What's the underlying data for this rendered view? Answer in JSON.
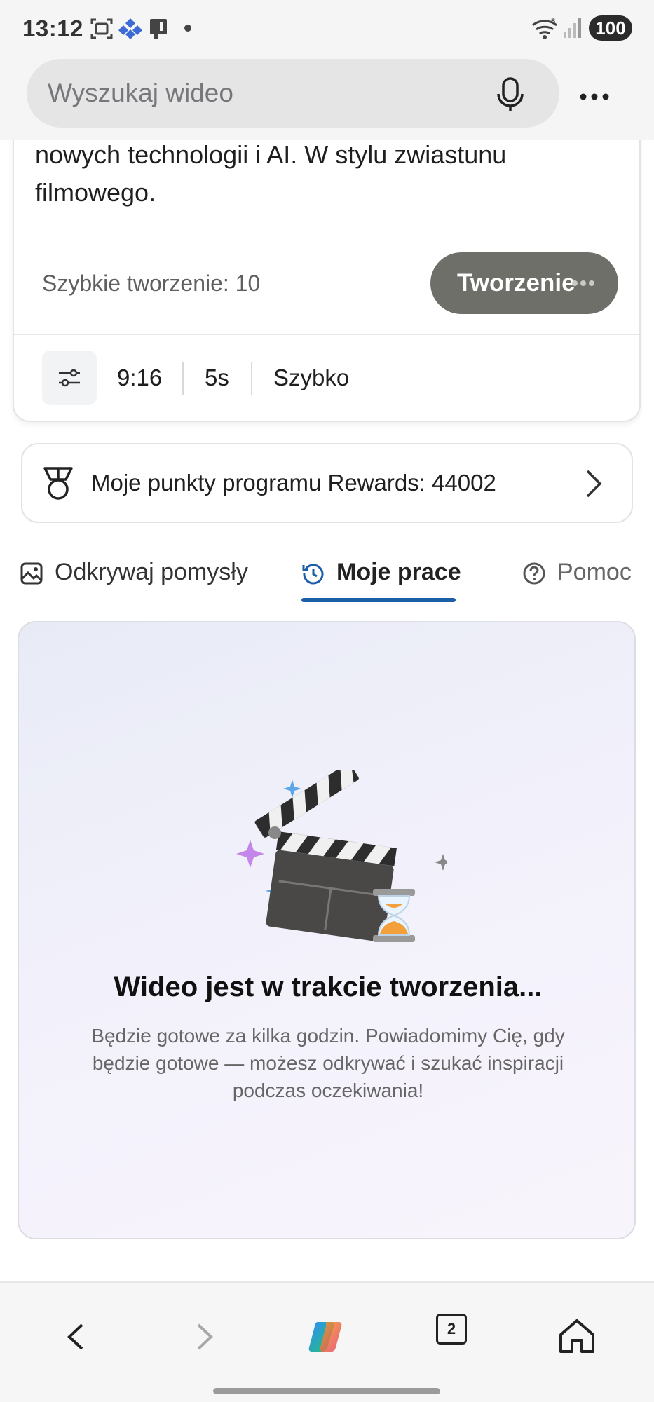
{
  "status_bar": {
    "time": "13:12",
    "battery": "100",
    "wifi_badge": "5"
  },
  "search": {
    "placeholder": "Wyszukaj wideo"
  },
  "prompt_card": {
    "text": "nowych technologii i AI. W stylu zwiastunu filmowego.",
    "quick_create_label": "Szybkie tworzenie: 10",
    "create_button": "Tworzenie",
    "options": {
      "aspect_ratio": "9:16",
      "duration": "5s",
      "speed": "Szybko"
    }
  },
  "rewards": {
    "label": "Moje punkty programu Rewards: 44002"
  },
  "tabs": [
    {
      "label": "Odkrywaj pomysły",
      "active": false
    },
    {
      "label": "Moje prace",
      "active": true
    },
    {
      "label": "Pomoc",
      "active": false
    }
  ],
  "status_card": {
    "title": "Wideo jest w trakcie tworzenia...",
    "description": "Będzie gotowe za kilka godzin. Powiadomimy Cię, gdy będzie gotowe — możesz odkrywać i szukać inspiracji podczas oczekiwania!"
  },
  "bottom_nav": {
    "tab_count": "2"
  },
  "colors": {
    "accent": "#1c5fa8",
    "create_button": "#6d6f68"
  }
}
